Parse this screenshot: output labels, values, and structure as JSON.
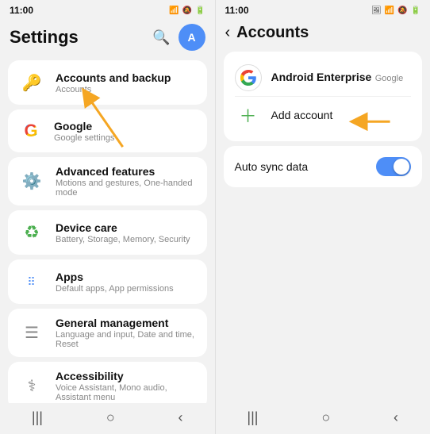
{
  "left": {
    "status": {
      "time": "11:00",
      "icons": "📶🔕🔋"
    },
    "title": "Settings",
    "items": [
      {
        "id": "accounts-backup",
        "icon": "🔑",
        "icon_color": "#f5a623",
        "title": "Accounts and backup",
        "subtitle": "Accounts"
      },
      {
        "id": "google",
        "icon": "G",
        "icon_type": "google",
        "title": "Google",
        "subtitle": "Google settings"
      },
      {
        "id": "advanced",
        "icon": "⚙️",
        "icon_color": "#f5a623",
        "title": "Advanced features",
        "subtitle": "Motions and gestures, One-handed mode"
      },
      {
        "id": "device-care",
        "icon": "♻",
        "icon_color": "#4caf50",
        "title": "Device care",
        "subtitle": "Battery, Storage, Memory, Security"
      },
      {
        "id": "apps",
        "icon": "⋮⋮",
        "icon_color": "#4e8ef7",
        "title": "Apps",
        "subtitle": "Default apps, App permissions"
      },
      {
        "id": "general",
        "icon": "☰",
        "icon_color": "#888",
        "title": "General management",
        "subtitle": "Language and input, Date and time, Reset"
      },
      {
        "id": "accessibility",
        "icon": "♿",
        "icon_color": "#888",
        "title": "Accessibility",
        "subtitle": "Voice Assistant, Mono audio, Assistant menu"
      }
    ],
    "nav": [
      "|||",
      "○",
      "<"
    ]
  },
  "right": {
    "status": {
      "time": "11:00",
      "icons": "🖼📶🔕🔋"
    },
    "title": "Accounts",
    "back_label": "<",
    "accounts_card": {
      "account_name": "Android Enterprise",
      "account_sub": "Google",
      "add_label": "Add account"
    },
    "sync_label": "Auto sync data",
    "nav": [
      "|||",
      "○",
      "<"
    ]
  },
  "arrows": {
    "left_arrow_label": "pointing to Accounts and backup",
    "right_arrow_label": "pointing to Add account"
  }
}
